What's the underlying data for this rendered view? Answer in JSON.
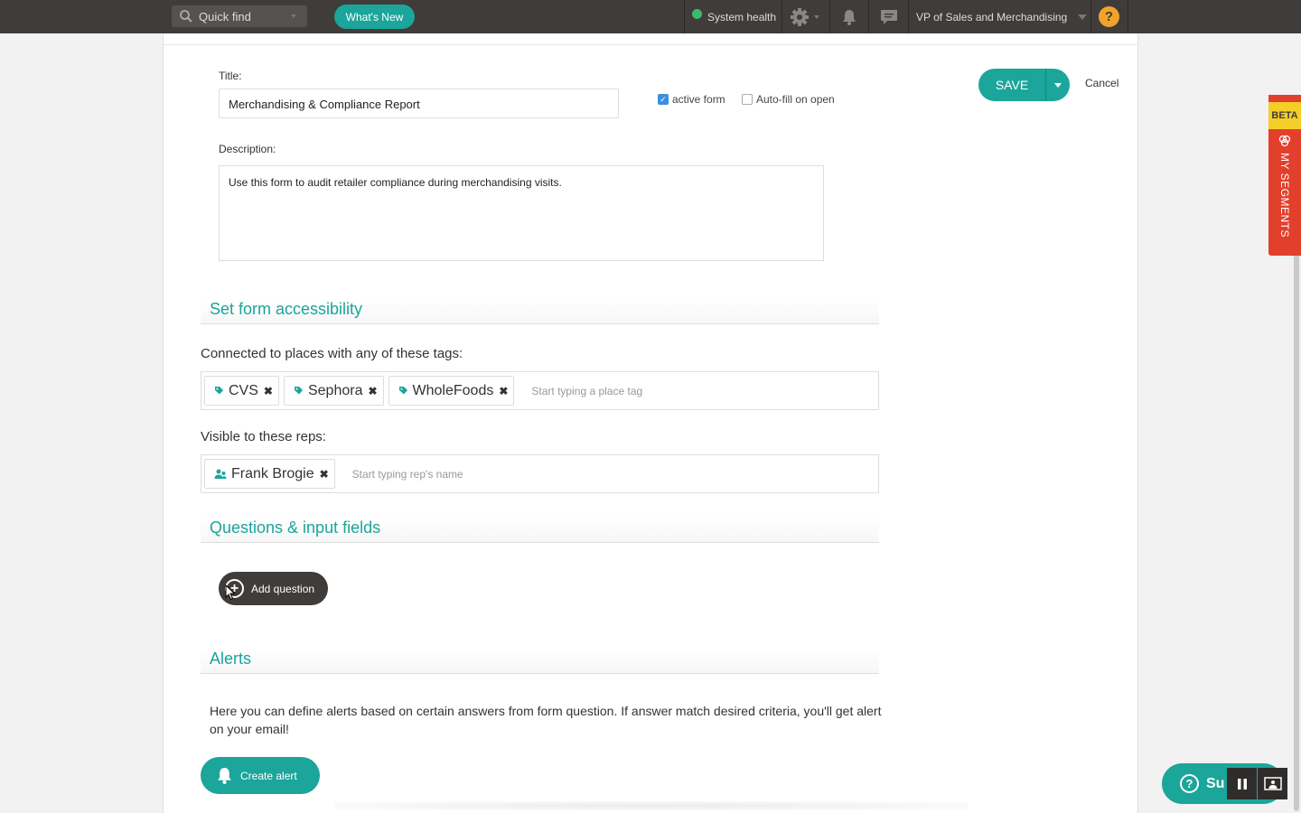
{
  "topbar": {
    "quick_find": "Quick find",
    "whats_new": "What's New",
    "system_health": "System health",
    "role": "VP of Sales and Merchandising",
    "help": "?",
    "icons": [
      "search-icon",
      "gear-icon",
      "bell-icon",
      "chat-icon"
    ]
  },
  "form": {
    "title_label": "Title:",
    "title_value": "Merchandising & Compliance Report",
    "active_form_label": "active form",
    "active_form_checked": true,
    "autofill_label": "Auto-fill on open",
    "autofill_checked": false,
    "save_label": "SAVE",
    "cancel_label": "Cancel",
    "description_label": "Description:",
    "description_value": "Use this form to audit retailer compliance during merchandising visits."
  },
  "accessibility": {
    "heading": "Set form accessibility",
    "tags_label": "Connected to places with any of these tags:",
    "tags": [
      "CVS",
      "Sephora",
      "WholeFoods"
    ],
    "tags_placeholder": "Start typing a place tag",
    "reps_label": "Visible to these reps:",
    "reps": [
      "Frank Brogie"
    ],
    "reps_placeholder": "Start typing rep's name"
  },
  "questions": {
    "heading": "Questions & input fields",
    "add_question_label": "Add question"
  },
  "alerts": {
    "heading": "Alerts",
    "description": "Here you can define alerts based on certain answers from form question. If answer match desired criteria, you'll get alert on your email!",
    "create_alert_label": "Create alert"
  },
  "side_tab": {
    "beta": "BETA",
    "label": "MY SEGMENTS"
  },
  "support": {
    "label": "Su"
  },
  "colors": {
    "accent": "#1ba59b",
    "topbar": "#3f3c3a",
    "beta_red": "#e2402d",
    "beta_yellow": "#f4cf2a",
    "help_orange": "#f1a22c",
    "health_green": "#3fb96b"
  }
}
